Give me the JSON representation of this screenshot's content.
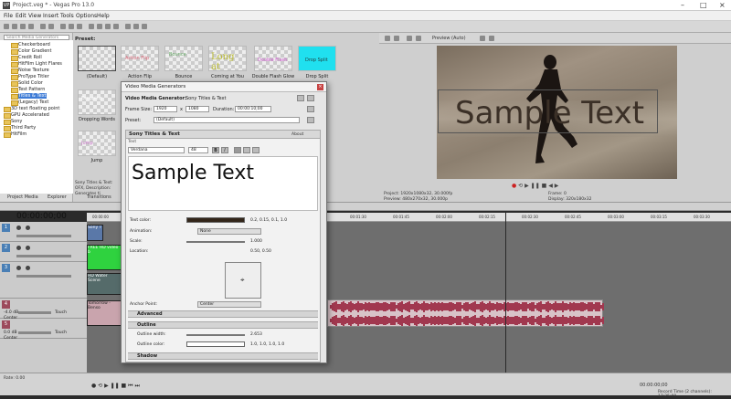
{
  "window": {
    "title": "Project.veg * - Vegas Pro 13.0",
    "app_icon": "VP"
  },
  "menu": [
    "File",
    "Edit",
    "View",
    "Insert",
    "Tools",
    "Options",
    "Help"
  ],
  "explorer": {
    "search_placeholder": "Search Media Generators",
    "tree": [
      "Checkerboard",
      "Color Gradient",
      "Credit Roll",
      "HitFilm Light Flares",
      "Noise Texture",
      "ProType Titler",
      "Solid Color",
      "Test Pattern",
      "Titles & Text",
      "(Legacy) Text",
      "3D text floating point",
      "GPU Accelerated",
      "Sony",
      "Third Party",
      "HitFilm"
    ],
    "selected_index": 8,
    "tabs": [
      "Project Media",
      "Explorer",
      "Transitions"
    ]
  },
  "presets": {
    "label": "Preset:",
    "items": [
      {
        "name": "(Default)",
        "thumb": ""
      },
      {
        "name": "Action Flip",
        "thumb": "Action Flip"
      },
      {
        "name": "Bounce",
        "thumb": "Bounce"
      },
      {
        "name": "Coming at You",
        "thumb": "Long at"
      },
      {
        "name": "Double Flash Glow",
        "thumb": "Double Flash"
      },
      {
        "name": "Drop Split",
        "thumb": "Drop Split"
      },
      {
        "name": "Dropping Words",
        "thumb": "Dropping"
      },
      {
        "name": "Jump",
        "thumb": "Jump"
      }
    ],
    "description": "Sony Titles & Text: OFX, Description: Generates ti"
  },
  "preview": {
    "mode": "Preview (Auto)",
    "sample_text": "Sample Text",
    "project_label": "Project:",
    "project_value": "1920x1080x32, 30.000fp",
    "preview_label": "Preview:",
    "preview_value": "480x270x32, 30.000p",
    "frame_label": "Frame:",
    "frame_value": "0",
    "display_label": "Display:",
    "display_value": "320x180x32"
  },
  "timeline": {
    "timecode": "00:00:00;00",
    "ruler": [
      "00:00:00",
      "00:00:15",
      "00:00:30",
      "00:00:45",
      "00:01:00",
      "00:01:15",
      "00:01:30",
      "00:01:45",
      "00:02:00",
      "00:02:15",
      "00:02:30",
      "00:02:45",
      "00:03:00",
      "00:03:15",
      "00:03:30"
    ],
    "clips": [
      "Sony T",
      "FREE HD video b",
      "HD Water Scene",
      "Tomorrow - Benso"
    ],
    "audio": {
      "db1": "-4.0 dB",
      "db2": "0.0 dB",
      "touch": "Touch",
      "pan": "Center"
    },
    "rate": "Rate: 0.00",
    "end_time": "00:00:00;00",
    "record_time": "Record Time (2 channels): 17:25:00"
  },
  "dialog": {
    "title": "Video Media Generators",
    "generator_label": "Video Media Generator:",
    "generator_name": "Sony Titles & Text",
    "frame_size_label": "Frame Size:",
    "width": "1920",
    "height": "1080",
    "duration_label": "Duration:",
    "duration": "00:00:10;00",
    "preset_label": "Preset:",
    "preset_value": "(Default)",
    "panel_title": "Sony Titles & Text",
    "about": "About",
    "text_label": "Text",
    "font": "Verdana",
    "font_size": "48",
    "edit_text": "Sample Text",
    "props": [
      {
        "label": "Text color:",
        "value": "0.2, 0.15, 0.1, 1.0"
      },
      {
        "label": "Animation:",
        "value": "None"
      },
      {
        "label": "Scale:",
        "value": "1.000"
      },
      {
        "label": "Location:",
        "value": "0.50, 0.50"
      },
      {
        "label": "Anchor Point:",
        "value": "Center"
      }
    ],
    "advanced": "Advanced",
    "outline": "Outline",
    "outline_width_label": "Outline width:",
    "outline_width": "2.653",
    "outline_color_label": "Outline color:",
    "outline_color": "1.0, 1.0, 1.0, 1.0",
    "shadow": "Shadow"
  },
  "colors": {
    "selection": "#3d7bd6",
    "cyan_thumb": "#20e0ef",
    "audio_wave": "#a1384f"
  }
}
